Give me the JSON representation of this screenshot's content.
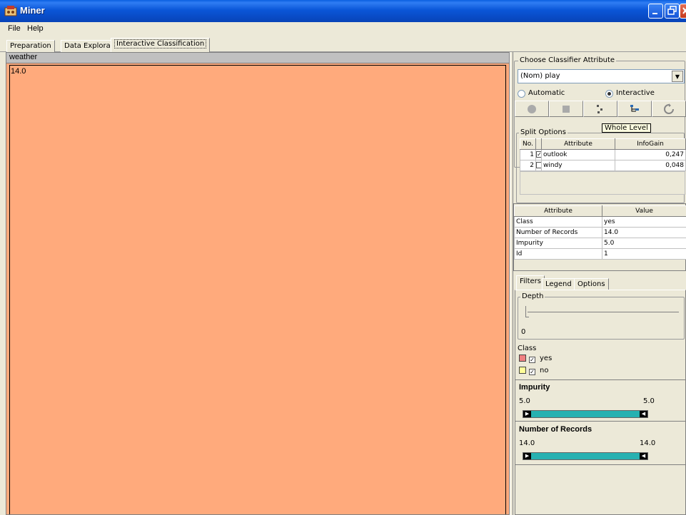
{
  "window": {
    "title": "Miner"
  },
  "menu": {
    "items": [
      "File",
      "Help"
    ]
  },
  "tabs": [
    {
      "label": "Preparation"
    },
    {
      "label": "Data Exploration"
    },
    {
      "label": "Interactive Classification"
    }
  ],
  "tree_view": {
    "title": "weather",
    "node_value": "14.0",
    "node_color": "#ffaa7c"
  },
  "classifier": {
    "group_label": "Choose Classifier Attribute",
    "selected": "(Nom) play",
    "modes": [
      "Automatic",
      "Interactive"
    ],
    "active_mode": "Interactive"
  },
  "split_options": {
    "group_label": "Split Options",
    "tooltip": "Whole Level",
    "columns": [
      "No.",
      "Attribute",
      "InfoGain"
    ],
    "rows": [
      {
        "no": "1",
        "checked": true,
        "attribute": "outlook",
        "gain": "0,247"
      },
      {
        "no": "2",
        "checked": false,
        "attribute": "windy",
        "gain": "0,048"
      }
    ]
  },
  "node_info": {
    "columns": [
      "Attribute",
      "Value"
    ],
    "rows": [
      {
        "attribute": "Class",
        "value": "yes"
      },
      {
        "attribute": "Number of Records",
        "value": "14.0"
      },
      {
        "attribute": "Impurity",
        "value": "5.0"
      },
      {
        "attribute": "Id",
        "value": "1"
      }
    ]
  },
  "bottom_tabs": [
    "Filters",
    "Legend",
    "Options"
  ],
  "filters": {
    "depth_label": "Depth",
    "depth_value": "0",
    "class_label": "Class",
    "classes": [
      {
        "name": "yes",
        "color": "#f08080",
        "checked": true
      },
      {
        "name": "no",
        "color": "#ffff99",
        "checked": true
      }
    ],
    "impurity": {
      "label": "Impurity",
      "min": "5.0",
      "max": "5.0"
    },
    "records": {
      "label": "Number of Records",
      "min": "14.0",
      "max": "14.0"
    }
  }
}
